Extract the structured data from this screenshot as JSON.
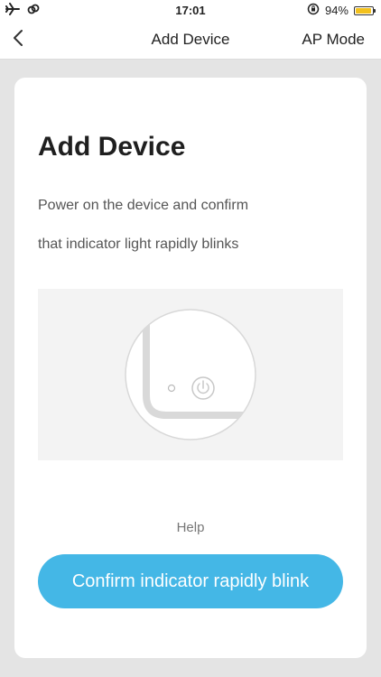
{
  "status_bar": {
    "time": "17:01",
    "battery_text": "94%",
    "battery_level": 0.94,
    "battery_color": "#f3c11d",
    "icons": [
      "airplane-icon",
      "link-icon",
      "rotation-lock-icon"
    ]
  },
  "nav": {
    "title": "Add Device",
    "right_label": "AP Mode",
    "back_icon": "chevron-left-icon"
  },
  "card": {
    "title": "Add Device",
    "description_line1": "Power on the device and confirm",
    "description_line2": "that indicator light rapidly blinks",
    "illustration_icon": "power-icon",
    "help_label": "Help",
    "confirm_label": "Confirm indicator rapidly blink",
    "accent_color": "#44b7e6"
  }
}
